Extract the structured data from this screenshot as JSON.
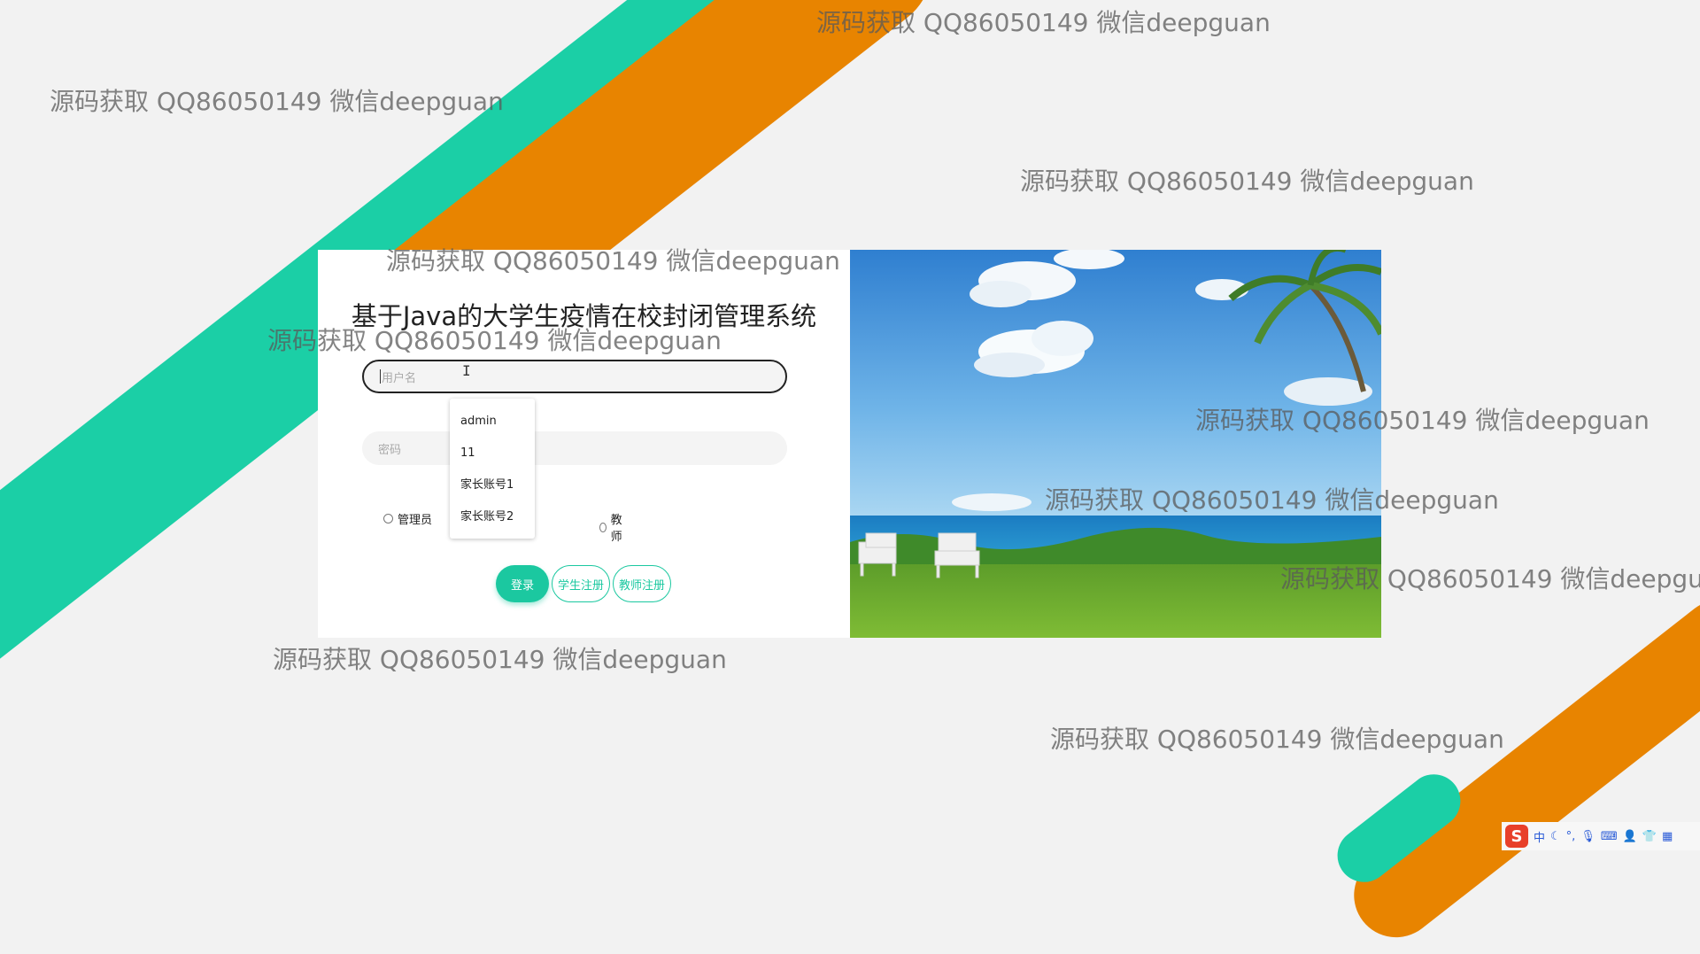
{
  "page": {
    "title": "基于Java的大学生疫情在校封闭管理系统"
  },
  "login": {
    "username_placeholder": "用户名",
    "password_placeholder": "密码",
    "roles": [
      "管理员",
      "教师"
    ],
    "buttons": {
      "login": "登录",
      "student_register": "学生注册",
      "teacher_register": "教师注册"
    }
  },
  "autocomplete": {
    "items": [
      "admin",
      "11",
      "家长账号1",
      "家长账号2"
    ]
  },
  "watermark": {
    "text": "源码获取 QQ86050149 微信deepguan"
  },
  "tray": {
    "ime_logo": "S",
    "ime_mode": "中",
    "icons": [
      "moon-icon",
      "punctuation-icon",
      "microphone-icon",
      "keyboard-icon",
      "user-icon",
      "shirt-icon",
      "grid-icon"
    ]
  },
  "colors": {
    "accent": "#1bc8a0",
    "stripe_teal": "#1bcfa6",
    "stripe_orange": "#e88400",
    "background": "#f2f2f2"
  }
}
